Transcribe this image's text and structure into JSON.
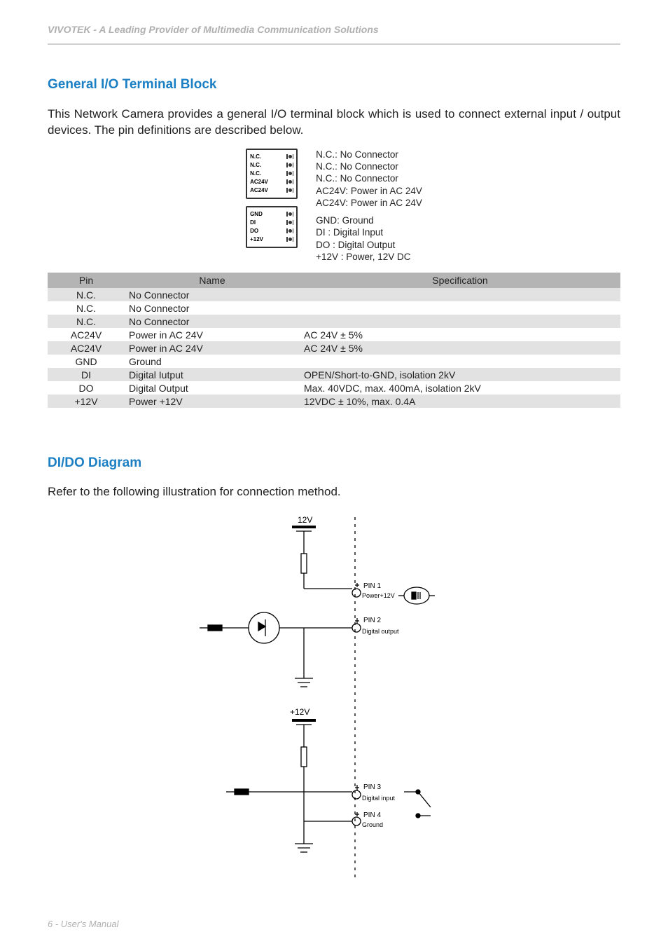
{
  "header": "VIVOTEK - A Leading Provider of Multimedia Communication Solutions",
  "section1": {
    "title": "General I/O Terminal Block",
    "intro": "This Network Camera provides a general I/O terminal block which is used to connect external input / output devices. The pin definitions are described below.",
    "block1_rows": [
      "N.C.",
      "N.C.",
      "N.C.",
      "AC24V",
      "AC24V"
    ],
    "block2_rows": [
      "GND",
      "DI",
      "DO",
      "+12V"
    ],
    "desc1": [
      "N.C.: No Connector",
      "N.C.: No Connector",
      "N.C.: No Connector",
      "AC24V: Power in AC 24V",
      "AC24V: Power in AC 24V"
    ],
    "desc2": [
      "GND: Ground",
      "DI  : Digital Input",
      "DO : Digital Output",
      "+12V : Power, 12V DC"
    ]
  },
  "table": {
    "headers": [
      "Pin",
      "Name",
      "Specification"
    ],
    "rows": [
      {
        "pin": "N.C.",
        "name": "No Connector",
        "spec": ""
      },
      {
        "pin": "N.C.",
        "name": "No Connector",
        "spec": ""
      },
      {
        "pin": "N.C.",
        "name": "No Connector",
        "spec": ""
      },
      {
        "pin": "AC24V",
        "name": "Power in AC 24V",
        "spec": "AC 24V ± 5%"
      },
      {
        "pin": "AC24V",
        "name": "Power in AC 24V",
        "spec": "AC 24V ± 5%"
      },
      {
        "pin": "GND",
        "name": "Ground",
        "spec": ""
      },
      {
        "pin": "DI",
        "name": "Digital Iutput",
        "spec": "OPEN/Short-to-GND, isolation 2kV"
      },
      {
        "pin": "DO",
        "name": "Digital Output",
        "spec": "Max. 40VDC, max. 400mA, isolation 2kV"
      },
      {
        "pin": "+12V",
        "name": "Power +12V",
        "spec": "12VDC ± 10%, max. 0.4A"
      }
    ]
  },
  "section2": {
    "title": "DI/DO Diagram",
    "intro": "Refer to the following illustration for connection method.",
    "labels": {
      "v12_top": "12V",
      "v12_mid": "+12V",
      "pin1": "PIN 1",
      "pin1_sub": "Power+12V",
      "pin2": "PIN 2",
      "pin2_sub": "Digital output",
      "pin3": "PIN 3",
      "pin3_sub": "Digital input",
      "pin4": "PIN 4",
      "pin4_sub": "Ground"
    }
  },
  "footer": "6 - User's Manual"
}
